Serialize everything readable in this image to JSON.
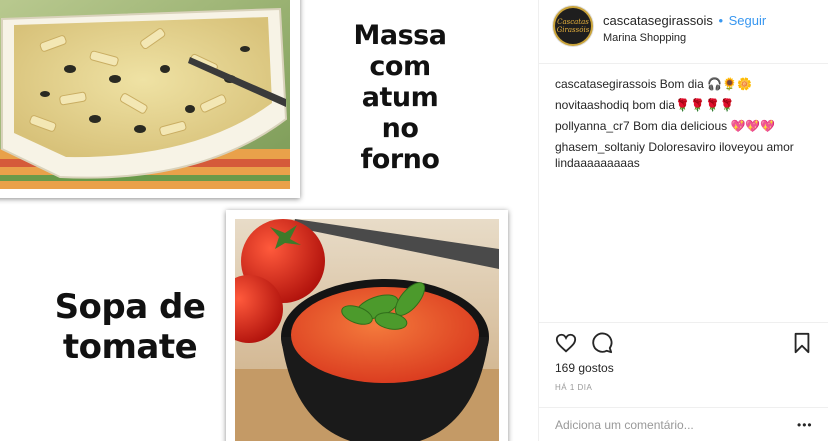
{
  "post_image": {
    "caption_top": [
      "Massa",
      "com",
      "atum",
      "no",
      "forno"
    ],
    "caption_bottom": [
      "Sopa de",
      "tomate"
    ]
  },
  "header": {
    "username": "cascatasegirassois",
    "separator": "•",
    "follow_label": "Seguir",
    "location": "Marina Shopping",
    "avatar_text": [
      "Cascatas",
      "Girassóis"
    ]
  },
  "comments": [
    {
      "user": "cascatasegirassois",
      "text": "Bom dia 🎧🌻🌼"
    },
    {
      "user": "novitaashodiq",
      "text": "bom dia🌹🌹🌹🌹"
    },
    {
      "user": "pollyanna_cr7",
      "text": "Bom dia delicious 💖💖💖"
    },
    {
      "user": "ghasem_soltaniy",
      "text": "Doloresaviro iloveyou amor lindaaaaaaaaas"
    }
  ],
  "actions": {
    "like_icon": "heart-outline-icon",
    "comment_icon": "speech-bubble-icon",
    "save_icon": "bookmark-icon"
  },
  "likes_label": "169 gostos",
  "time_label": "HÁ 1 DIA",
  "add_comment": {
    "placeholder": "Adiciona um comentário...",
    "more_icon": "•••"
  },
  "colors": {
    "link_blue": "#3897f0",
    "text": "#262626",
    "muted": "#999999",
    "divider": "#efefef"
  }
}
